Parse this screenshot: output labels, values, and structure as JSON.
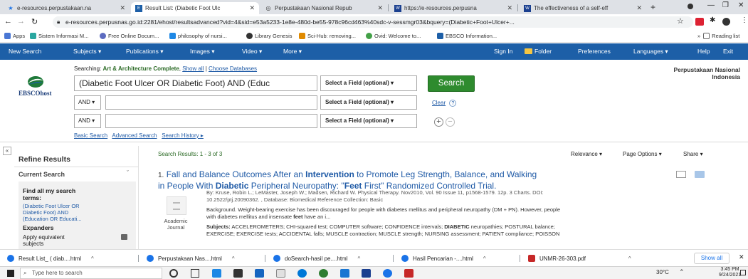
{
  "browser": {
    "tabs": [
      {
        "title": "e-resources.perpustakaan.na",
        "active": false
      },
      {
        "title": "Result List: (Diabetic Foot Ulc",
        "active": true
      },
      {
        "title": "Perpustakaan Nasional Repub",
        "active": false
      },
      {
        "title": "https://e-resources.perpusna",
        "active": false
      },
      {
        "title": "The effectiveness of a self-eff",
        "active": false
      }
    ],
    "url": "e-resources.perpusnas.go.id:2281/ehost/resultsadvanced?vid=4&sid=e53a5233-1e8e-480d-be55-978c96cd463%40sdc-v-sessmgr03&bquery=(Diabetic+Foot+Ulcer+...",
    "bookmarks": [
      "Apps",
      "Sistem Informasi M...",
      "Free Online Docum...",
      "philosophy of nursi...",
      "Library Genesis",
      "Sci-Hub: removing...",
      "Ovid: Welcome to...",
      "EBSCO Information..."
    ],
    "reading_list": "Reading list"
  },
  "nav": {
    "left": [
      "New Search",
      "Subjects ▾",
      "Publications ▾",
      "Images ▾",
      "Video ▾",
      "More ▾"
    ],
    "right": [
      "Sign In",
      "Folder",
      "Preferences",
      "Languages ▾",
      "Help",
      "Exit"
    ]
  },
  "search": {
    "logo": "EBSCOhost",
    "searching_label": "Searching:",
    "database": "Art & Architecture Complete",
    "show_all": "Show all",
    "choose_db": "Choose Databases",
    "query1": "(Diabetic Foot Ulcer OR Diabetic Foot) AND (Educ",
    "field_label": "Select a Field (optional) ▾",
    "bool_op": "AND ▾",
    "search_button": "Search",
    "clear": "Clear",
    "help": "?",
    "basic": "Basic Search",
    "advanced": "Advanced Search",
    "history": "Search History ▸",
    "institution_line1": "Perpustakaan Nasional",
    "institution_line2": "Indonesia"
  },
  "refine": {
    "title": "Refine Results",
    "current_search": "Current Search",
    "find_all_line1": "Find all my search",
    "find_all_line2": "terms:",
    "terms_line1": "(Diabetic Foot Ulcer OR",
    "terms_line2": "Diabetic Foot) AND",
    "terms_line3": "(Education OR Educati...",
    "expanders": "Expanders",
    "apply_line1": "Apply equivalent",
    "apply_line2": "subjects",
    "collapse": "«"
  },
  "results": {
    "summary": "Search Results: 1 - 3 of 3",
    "relevance": "Relevance ▾",
    "page_options": "Page Options ▾",
    "share": "Share ▾",
    "item": {
      "number": "1.",
      "title_a": "Fall and Balance Outcomes After an ",
      "title_b": "Intervention",
      "title_c": " to Promote Leg Strength, Balance, and Walking",
      "title_d": "in People With ",
      "title_e": "Diabetic",
      "title_f": " Peripheral Neuropathy: \"",
      "title_g": "Feet",
      "title_h": " First\" Randomized Controlled Trial.",
      "byline1": "By: Kruse, Robin L.; LeMaster, Joseph W.; Madsen, Richard W. Physical Therapy. Nov2010, Vol. 90 Issue 11, p1568-1579. 12p. 3 Charts. DOI:",
      "byline2": "10.2522/ptj.20090362. , Database: Biomedical Reference Collection: Basic",
      "abstract1": "Background. Weight-bearing exercise has been discouraged for people with diabetes mellitus and peripheral neuropathy (DM + PN). However, people",
      "abstract2a": "with diabetes mellitus and insensate ",
      "abstract2b": "feet",
      "abstract2c": " have an i...",
      "subjects_label": "Subjects:",
      "subjects1a": " ACCELEROMETERS; CHI-squared test; COMPUTER software; CONFIDENCE intervals; ",
      "subjects1b": "DIABETIC",
      "subjects1c": " neuropathies; POSTURAL balance;",
      "subjects2": "EXERCISE; EXERCISE tests; ACCIDENTAL falls; MUSCLE contraction; MUSCLE strength; NURSING assessment; PATIENT compliance; POISSON",
      "type_line1": "Academic",
      "type_line2": "Journal"
    }
  },
  "downloads": {
    "items": [
      "Result List_ ( diab....html",
      "Perpustakaan Nas....html",
      "doSearch-hasil pe....html",
      "Hasil Pencarian -....html",
      "UNMR-26-303.pdf"
    ],
    "show_all": "Show all"
  },
  "taskbar": {
    "search_placeholder": "Type here to search",
    "temp": "30°C",
    "time": "3:45 PM",
    "date": "9/24/2021"
  },
  "colors": {
    "nav_bg": "#1d5fa7",
    "search_btn": "#2e8b2e",
    "link": "#1f5aa6"
  }
}
